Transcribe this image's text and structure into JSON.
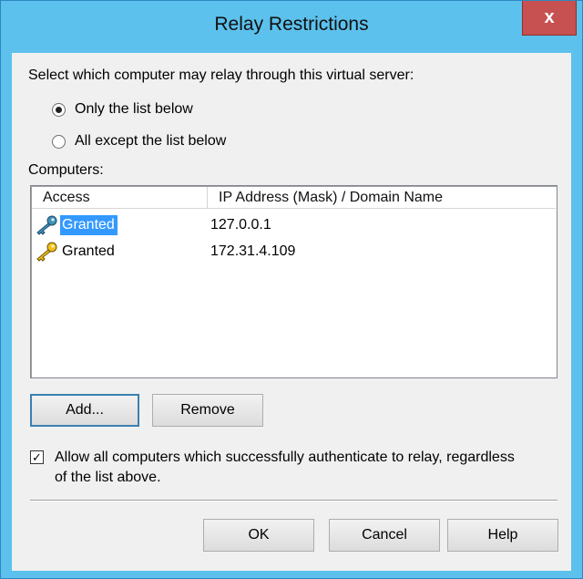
{
  "window": {
    "title": "Relay Restrictions",
    "close_glyph": "x"
  },
  "prompt": "Select which computer may relay through this virtual server:",
  "options": {
    "only_list": "Only the list below",
    "all_except": "All except the list below",
    "selected": "only_list"
  },
  "computers_label": "Computers:",
  "list": {
    "columns": [
      "Access",
      "IP Address (Mask) / Domain Name"
    ],
    "rows": [
      {
        "access": "Granted",
        "address": "127.0.0.1",
        "selected": true,
        "icon": "key-icon"
      },
      {
        "access": "Granted",
        "address": "172.31.4.109",
        "selected": false,
        "icon": "key-icon"
      }
    ]
  },
  "buttons": {
    "add": "Add...",
    "remove": "Remove",
    "ok": "OK",
    "cancel": "Cancel",
    "help": "Help"
  },
  "authenticate": {
    "checked": true,
    "line1": "Allow all computers which successfully authenticate to relay, regardless",
    "line2": "of the list above."
  },
  "colors": {
    "frame": "#5cc1ec",
    "close": "#c75050",
    "selection": "#3399ff"
  }
}
